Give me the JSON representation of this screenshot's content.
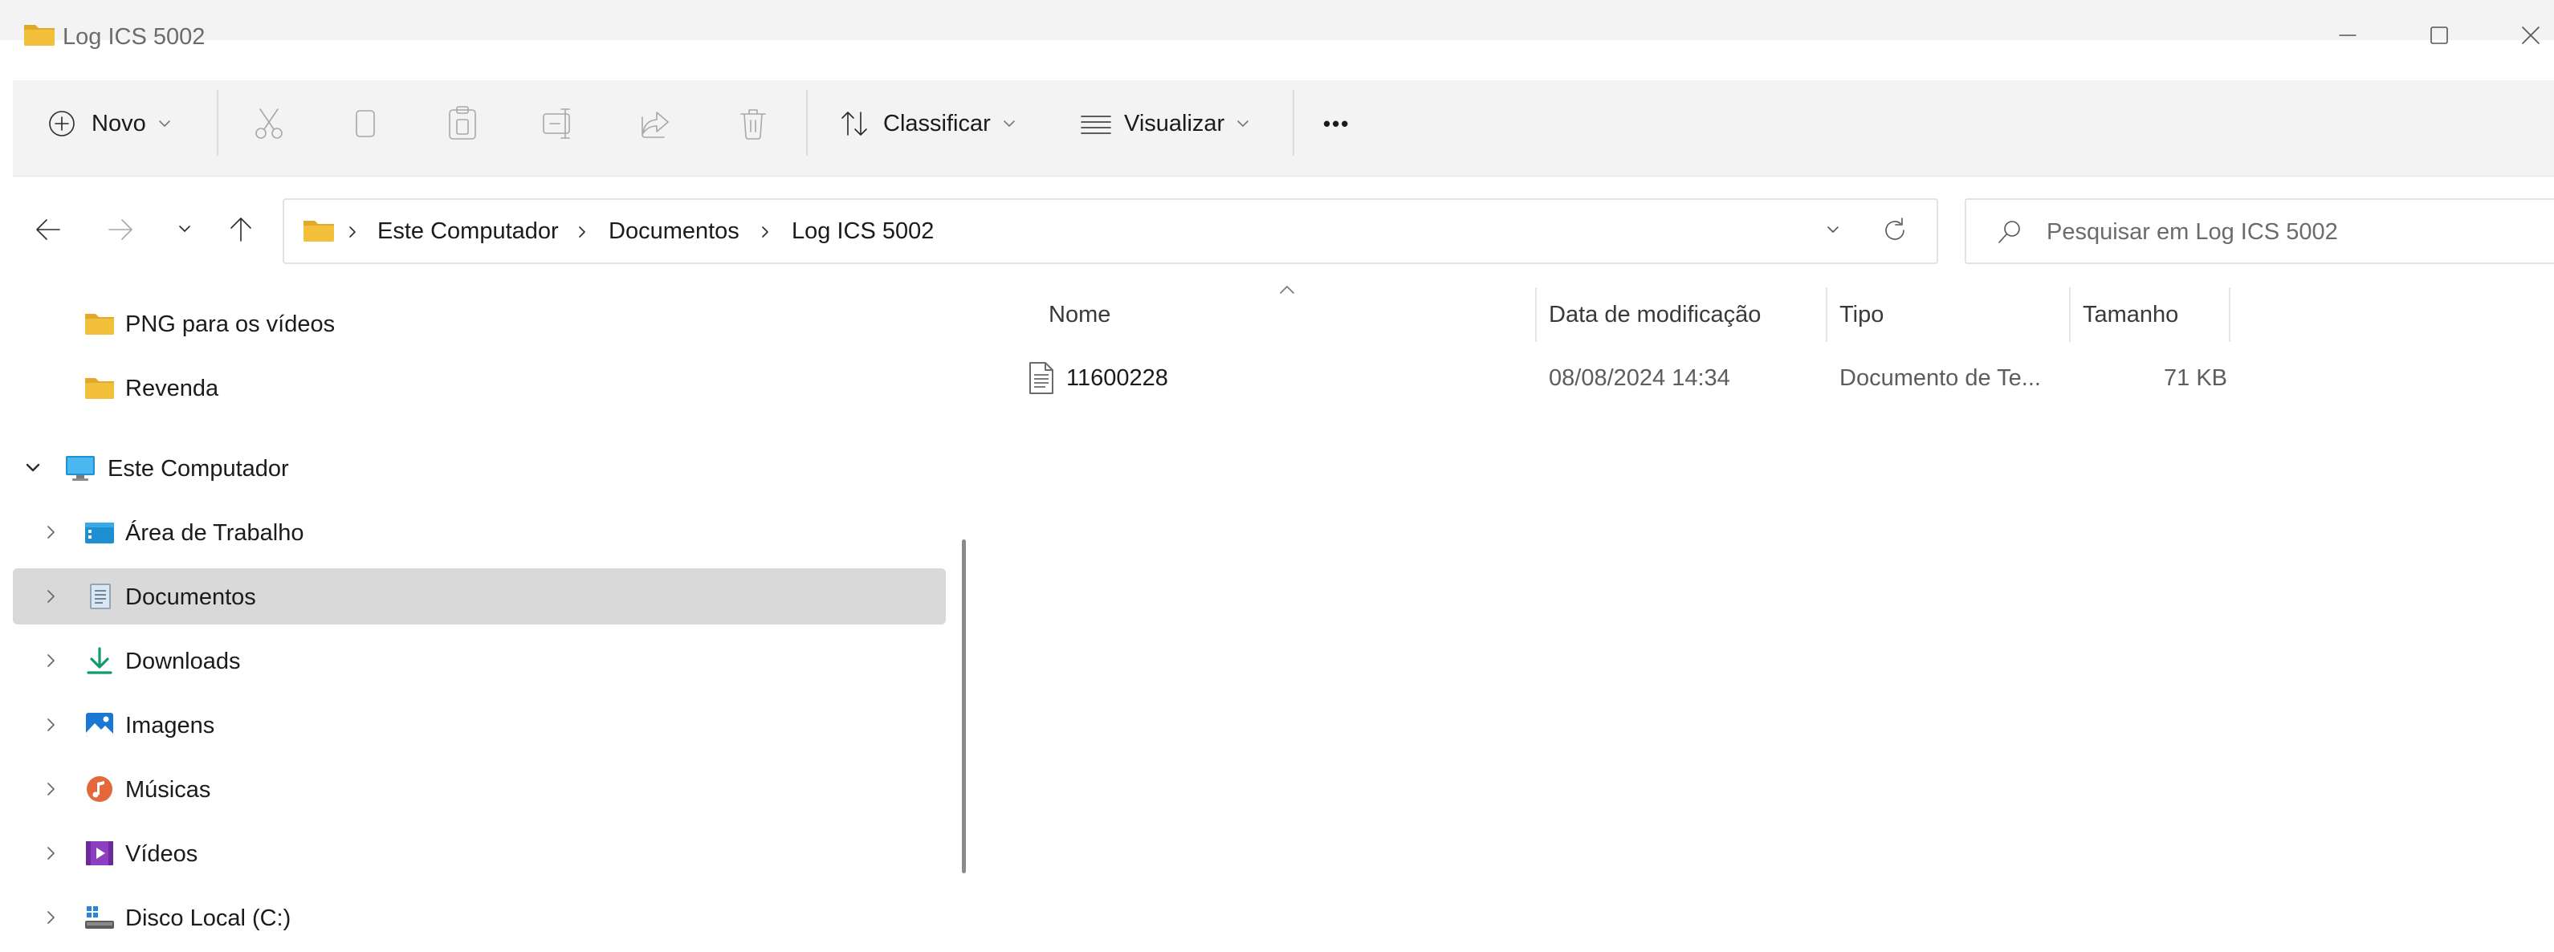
{
  "window": {
    "title": "Log ICS 5002",
    "controls": [
      "minimize",
      "maximize",
      "close"
    ]
  },
  "toolbar": {
    "new_label": "Novo",
    "sort_label": "Classificar",
    "view_label": "Visualizar",
    "more_label": "•••",
    "icons": [
      "cut-icon",
      "copy-icon",
      "paste-icon",
      "rename-icon",
      "share-icon",
      "delete-icon"
    ]
  },
  "address": {
    "crumbs": [
      "Este Computador",
      "Documentos",
      "Log ICS 5002"
    ]
  },
  "search": {
    "placeholder": "Pesquisar em Log ICS 5002"
  },
  "nav": {
    "items": [
      {
        "label": "PNG para os vídeos",
        "icon": "folder-icon"
      },
      {
        "label": "Revenda",
        "icon": "folder-icon"
      },
      {
        "label": "Este Computador",
        "icon": "computer-icon",
        "expanded": true
      },
      {
        "label": "Área de Trabalho",
        "icon": "desktop-icon"
      },
      {
        "label": "Documentos",
        "icon": "documents-icon",
        "selected": true
      },
      {
        "label": "Downloads",
        "icon": "downloads-icon"
      },
      {
        "label": "Imagens",
        "icon": "pictures-icon"
      },
      {
        "label": "Músicas",
        "icon": "music-icon"
      },
      {
        "label": "Vídeos",
        "icon": "videos-icon"
      },
      {
        "label": "Disco Local (C:)",
        "icon": "drive-icon"
      }
    ]
  },
  "list": {
    "columns": {
      "name": "Nome",
      "modified": "Data de modificação",
      "type": "Tipo",
      "size": "Tamanho"
    },
    "rows": [
      {
        "name": "11600228",
        "modified": "08/08/2024 14:34",
        "type": "Documento de Te...",
        "size": "71 KB"
      }
    ]
  },
  "colors": {
    "folder": "#f3c03c",
    "folder_dark": "#e1a82a",
    "selected_row": "#d9d9d9",
    "chrome": "#f3f3f3"
  }
}
